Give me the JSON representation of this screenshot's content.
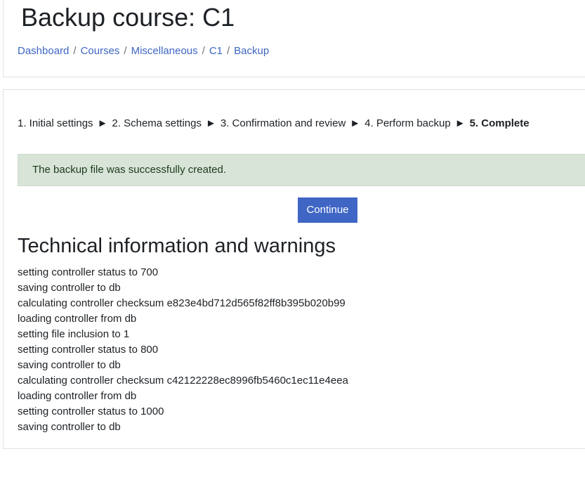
{
  "header": {
    "title": "Backup course: C1",
    "breadcrumb": [
      "Dashboard",
      "Courses",
      "Miscellaneous",
      "C1",
      "Backup"
    ],
    "separator": "/"
  },
  "steps": {
    "items": [
      "1. Initial settings",
      "2. Schema settings",
      "3. Confirmation and review",
      "4. Perform backup",
      "5. Complete"
    ],
    "arrow": "►",
    "current_index": 4
  },
  "alert": {
    "message": "The backup file was successfully created."
  },
  "continue_button": {
    "label": "Continue"
  },
  "technical": {
    "heading": "Technical information and warnings",
    "lines": [
      "setting controller status to 700",
      "saving controller to db",
      "calculating controller checksum e823e4bd712d565f82ff8b395b020b99",
      "loading controller from db",
      "setting file inclusion to 1",
      "setting controller status to 800",
      "saving controller to db",
      "calculating controller checksum c42122228ec8996fb5460c1ec11e4eea",
      "loading controller from db",
      "setting controller status to 1000",
      "saving controller to db"
    ]
  },
  "colors": {
    "link": "#3f66c4",
    "button_bg": "#3f66c4",
    "alert_bg": "#d8e4d8",
    "text": "#1d2125"
  }
}
